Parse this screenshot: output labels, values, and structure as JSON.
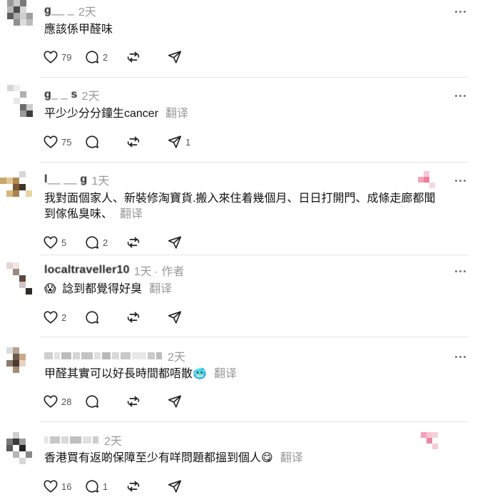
{
  "actions": {
    "like_label": "",
    "reply_label": "",
    "repost_label": "",
    "share_label": ""
  },
  "comments": [
    {
      "name": "g__ _",
      "time": "2天",
      "text": "應該係甲醛味",
      "translate": "",
      "likes": "79",
      "replies": "2",
      "reposts": "",
      "shares": ""
    },
    {
      "name": "g_ _ s",
      "time": "2天",
      "text": "平少少分分鐘生cancer",
      "translate": "翻译",
      "likes": "75",
      "replies": "",
      "reposts": "",
      "shares": "1"
    },
    {
      "name": "l__ __ g",
      "time": "1天",
      "text": "我對面個家人、新裝修淘寶貨.搬入來住着幾個月、日日打開門、成條走廊都聞到傢俬臭味、",
      "translate": "翻译",
      "likes": "5",
      "replies": "2",
      "reposts": "",
      "shares": ""
    },
    {
      "name": "localtraveller10",
      "time": "1天",
      "author_tag": "· 作者",
      "emoji": "😱",
      "text": "諗到都覺得好臭",
      "translate": "翻译",
      "likes": "2",
      "replies": "",
      "reposts": "",
      "shares": ""
    },
    {
      "name": "",
      "time": "2天",
      "text": "甲醛其實可以好長時間都唔散",
      "emoji_after": "🥶",
      "translate": "翻译",
      "likes": "28",
      "replies": "",
      "reposts": "",
      "shares": ""
    },
    {
      "name": "",
      "time": "2天",
      "text": "香港買有返啲保障至少有咩問題都搵到個人",
      "emoji_after": "😋",
      "translate": "翻译",
      "likes": "16",
      "replies": "1",
      "reposts": "",
      "shares": ""
    }
  ],
  "colors": {
    "divider": "#e6e6e6",
    "muted": "#999999",
    "icon": "#222222"
  }
}
